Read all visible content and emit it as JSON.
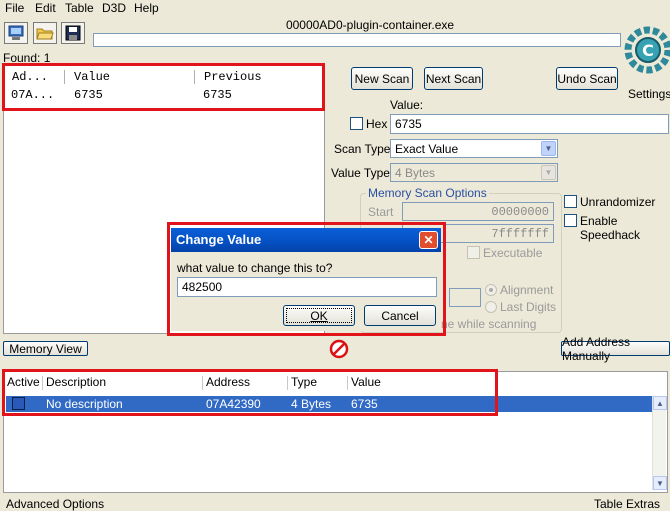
{
  "menu": [
    "File",
    "Edit",
    "Table",
    "D3D",
    "Help"
  ],
  "process_title": "00000AD0-plugin-container.exe",
  "found_label": "Found: 1",
  "results": {
    "headers": [
      "Ad...",
      "Value",
      "Previous"
    ],
    "rows": [
      {
        "address": "07A...",
        "value": "6735",
        "previous": "6735"
      }
    ]
  },
  "buttons": {
    "new_scan": "New Scan",
    "next_scan": "Next Scan",
    "undo_scan": "Undo Scan",
    "settings": "Settings",
    "memory_view": "Memory View",
    "add_address": "Add Address Manually"
  },
  "scan": {
    "value_label": "Value:",
    "hex_label": "Hex",
    "value": "6735",
    "scan_type_label": "Scan Type",
    "scan_type": "Exact Value",
    "value_type_label": "Value Type",
    "value_type": "4 Bytes"
  },
  "memory_options": {
    "legend": "Memory Scan Options",
    "start_label": "Start",
    "start": "00000000",
    "stop": "7fffffff",
    "executable": "Executable",
    "alignment": "Alignment",
    "last_digits": "Last Digits",
    "pause_text": "ne while scanning"
  },
  "options": {
    "unrandomizer": "Unrandomizer",
    "enable_speedhack": "Enable Speedhack"
  },
  "dialog": {
    "title": "Change Value",
    "prompt": "what value to change this to?",
    "input_value": "482500",
    "ok": "OK",
    "cancel": "Cancel"
  },
  "address_list": {
    "headers": [
      "Active",
      "Description",
      "Address",
      "Type",
      "Value"
    ],
    "rows": [
      {
        "description": "No description",
        "address": "07A42390",
        "type": "4 Bytes",
        "value": "6735"
      }
    ]
  },
  "status": {
    "advanced_options": "Advanced Options",
    "table_extras": "Table Extras"
  },
  "colors": {
    "accent_red": "#e1141c",
    "selection": "#316ac5",
    "title_blue": "#0550c2"
  }
}
